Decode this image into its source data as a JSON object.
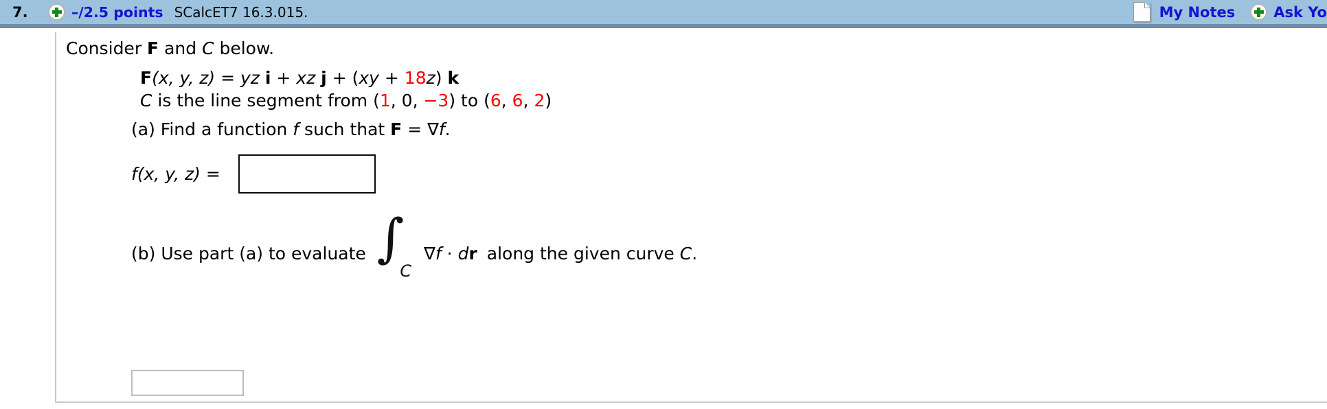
{
  "header": {
    "question_number": "7.",
    "add_icon": "plus-circle-icon",
    "points": "–/2.5 points",
    "problem_id": "SCalcET7 16.3.015.",
    "notes_icon": "document-page-icon",
    "my_notes_label": "My Notes",
    "ask_icon": "plus-circle-icon",
    "ask_teacher_label": "Ask Yo",
    "bar_color": "#9dc2de",
    "bar_border_color": "#6f8eaa",
    "link_color": "#1414d2"
  },
  "problem": {
    "intro": {
      "prefix": "Consider ",
      "vector_field": "F",
      "middle": " and ",
      "curve": "C",
      "suffix": " below."
    },
    "field_equation": {
      "F": "F",
      "args": "(x, y, z)",
      "equals": " = ",
      "term1": "yz",
      "i": "i",
      "plus1": " + ",
      "term2": "xz",
      "j": "j",
      "plus2": " + (",
      "term3": "xy",
      "plus3": " + ",
      "coefficient": "18",
      "var_z": "z",
      "close": ") ",
      "k": "k"
    },
    "curve_line": {
      "curve": "C",
      "text_before": " is the line segment from (",
      "start_x": "1",
      "comma1": ", ",
      "start_y": "0",
      "comma2": ", ",
      "start_z": "−3",
      "text_middle": ") to (",
      "end_x": "6",
      "comma3": ", ",
      "end_y": "6",
      "comma4": ", ",
      "end_z": "2",
      "text_after": ")"
    },
    "highlight_color": "#fb0007"
  },
  "part_a": {
    "label": "(a) Find a function ",
    "func": "f",
    "label2": " such that ",
    "F": "F",
    "equals": " = ",
    "grad": "∇",
    "func2": "f",
    "period": ".",
    "answer_label_f": "f",
    "answer_label_args": "(x, y, z) = ",
    "answer_value": "",
    "answer_placeholder": ""
  },
  "part_b": {
    "label": "(b) Use part (a) to evaluate",
    "integral_sign": "∫",
    "integral_subscript": "C",
    "integrand_grad": "∇",
    "integrand_f": "f",
    "dot": " · ",
    "differential_d": "d",
    "differential_r": "r",
    "tail": "along the given curve ",
    "curve": "C",
    "period": ".",
    "answer_value": "",
    "answer_placeholder": ""
  }
}
